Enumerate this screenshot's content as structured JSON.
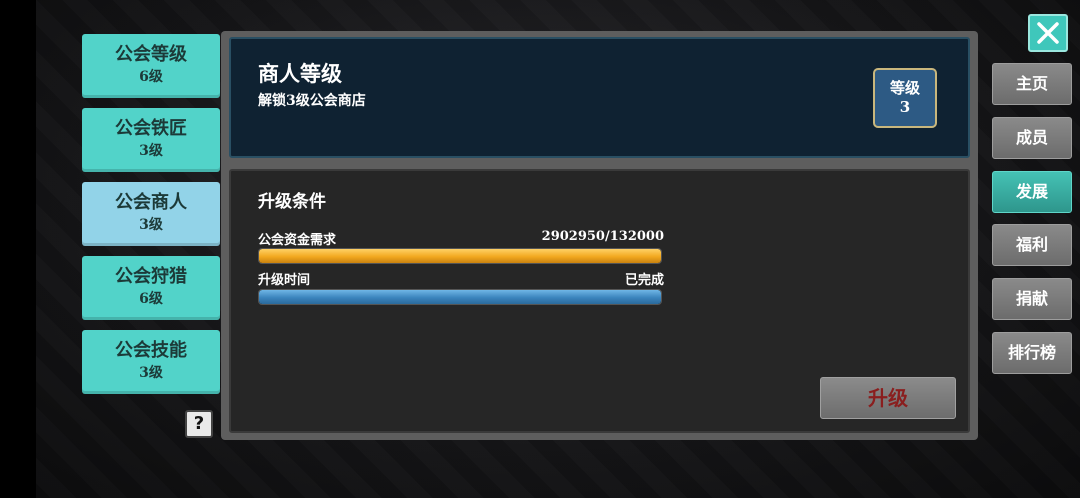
{
  "left_tabs": [
    {
      "name": "公会等级",
      "level": "6级"
    },
    {
      "name": "公会铁匠",
      "level": "3级"
    },
    {
      "name": "公会商人",
      "level": "3级"
    },
    {
      "name": "公会狩猎",
      "level": "6级"
    },
    {
      "name": "公会技能",
      "level": "3级"
    }
  ],
  "selected_left_tab": "公会商人",
  "help_label": "?",
  "header": {
    "title": "商人等级",
    "subtitle": "解锁3级公会商店",
    "badge_label": "等级",
    "badge_value": "3"
  },
  "conditions": {
    "title": "升级条件",
    "funds_label": "公会资金需求",
    "funds_value": "2902950/132000",
    "funds_progress": 1.0,
    "time_label": "升级时间",
    "time_value": "已完成",
    "time_progress": 1.0
  },
  "upgrade_button": "升级",
  "right_nav": [
    {
      "label": "主页"
    },
    {
      "label": "成员"
    },
    {
      "label": "发展"
    },
    {
      "label": "福利"
    },
    {
      "label": "捐献"
    },
    {
      "label": "排行榜"
    }
  ],
  "active_right_nav": "发展",
  "colors": {
    "teal_tab": "#52d3c9",
    "selected_tab": "#92d3e8",
    "active_nav": "#3fb5a9",
    "gold_bar": "#f2a81f",
    "blue_bar": "#3b84bd",
    "upgrade_text": "#8a1e1e"
  },
  "icons": {
    "close": "close-icon",
    "help": "help-icon"
  }
}
